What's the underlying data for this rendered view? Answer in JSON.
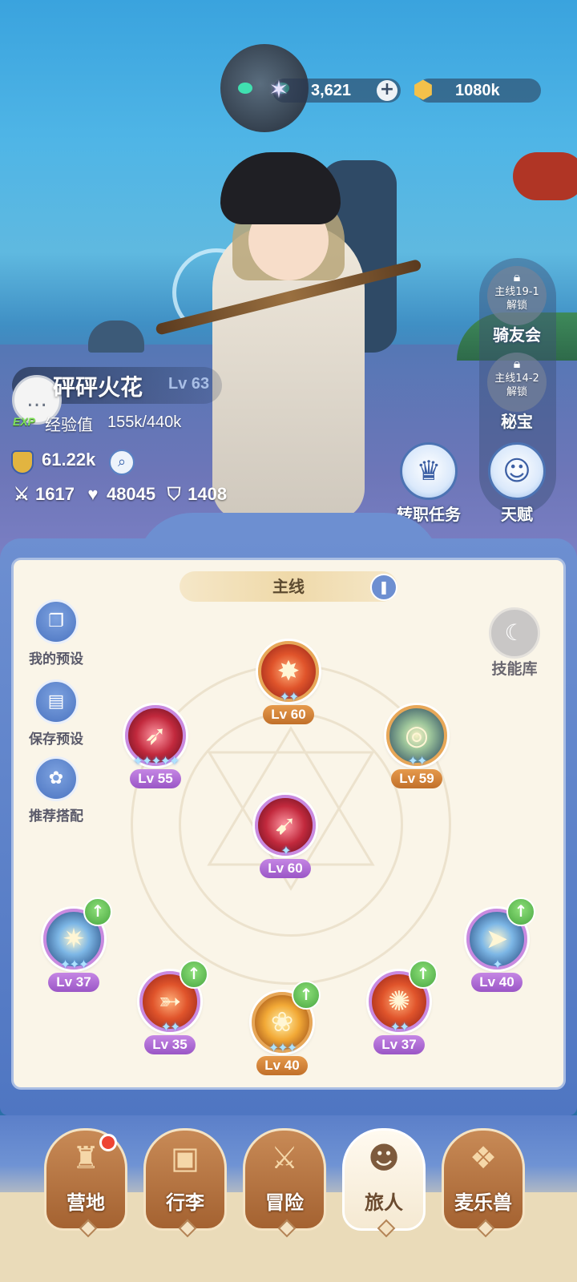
{
  "currency": {
    "stars": {
      "icon": "star-crystal-icon",
      "value": "3,621",
      "add": "+"
    },
    "gold": {
      "icon": "gold-coin-icon",
      "value": "1080k"
    }
  },
  "side_buttons": {
    "riding_club": {
      "unlock": "主线19-1\n解锁",
      "line1": "主线19-1",
      "line2": "解锁",
      "label": "骑友会"
    },
    "treasure": {
      "line1": "主线14-2",
      "line2": "解锁",
      "label": "秘宝"
    },
    "job_quest": {
      "label": "转职任务",
      "icon": "crown-icon"
    },
    "talent": {
      "label": "天赋",
      "icon": "brain-head-icon"
    }
  },
  "player": {
    "name": "砰砰火花",
    "level": "Lv 63",
    "exp_tag": "EXP",
    "exp_label": "经验值",
    "exp_value": "155k/440k",
    "power": "61.22k",
    "attack": "1617",
    "hp": "48045",
    "defense": "1408"
  },
  "panel": {
    "tab": "主线",
    "left_buttons": [
      "我的预设",
      "保存预设",
      "推荐搭配"
    ],
    "skill_library": "技能库"
  },
  "skills": [
    {
      "id": "top",
      "lv": "Lv 60",
      "stars": "✦✦"
    },
    {
      "id": "left",
      "lv": "Lv 55",
      "stars": "✦✦✦✦✦"
    },
    {
      "id": "right",
      "lv": "Lv 59",
      "stars": "✦✦"
    },
    {
      "id": "center",
      "lv": "Lv 60",
      "stars": "✦"
    },
    {
      "id": "b1",
      "lv": "Lv 37",
      "stars": "✦✦✦"
    },
    {
      "id": "b2",
      "lv": "Lv 35",
      "stars": "✦✦"
    },
    {
      "id": "b3",
      "lv": "Lv 40",
      "stars": "✦✦✦"
    },
    {
      "id": "b4",
      "lv": "Lv 37",
      "stars": "✦✦"
    },
    {
      "id": "b5",
      "lv": "Lv 40",
      "stars": "✦"
    }
  ],
  "nav": [
    {
      "label": "营地",
      "icon": "castle-icon",
      "badge": true
    },
    {
      "label": "行李",
      "icon": "backpack-icon"
    },
    {
      "label": "冒险",
      "icon": "crossed-swords-icon"
    },
    {
      "label": "旅人",
      "icon": "traveler-avatar-icon",
      "active": true
    },
    {
      "label": "麦乐兽",
      "icon": "pet-fox-icon"
    }
  ]
}
